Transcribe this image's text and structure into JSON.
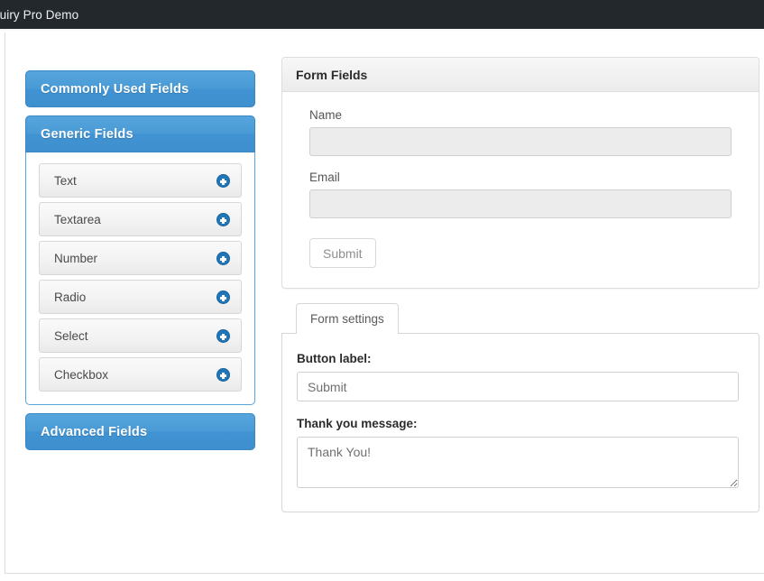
{
  "adminbar": {
    "title": "quiry Pro Demo"
  },
  "sidebar": {
    "panels": [
      {
        "label": "Commonly Used Fields",
        "state": "collapsed"
      },
      {
        "label": "Generic Fields",
        "state": "expanded"
      },
      {
        "label": "Advanced Fields",
        "state": "collapsed"
      }
    ],
    "generic_fields": [
      {
        "label": "Text",
        "icon": "plus-circle-icon"
      },
      {
        "label": "Textarea",
        "icon": "plus-circle-icon"
      },
      {
        "label": "Number",
        "icon": "plus-circle-icon"
      },
      {
        "label": "Radio",
        "icon": "plus-circle-icon"
      },
      {
        "label": "Select",
        "icon": "plus-circle-icon"
      },
      {
        "label": "Checkbox",
        "icon": "plus-circle-icon"
      }
    ]
  },
  "form_fields_card": {
    "title": "Form Fields",
    "fields": [
      {
        "label": "Name",
        "value": "",
        "placeholder": ""
      },
      {
        "label": "Email",
        "value": "",
        "placeholder": ""
      }
    ],
    "submit_label": "Submit"
  },
  "settings_card": {
    "tabs": [
      {
        "label": "Form settings",
        "active": true
      }
    ],
    "button_label_caption": "Button label:",
    "button_label_value": "Submit",
    "thank_you_caption": "Thank you message:",
    "thank_you_value": "Thank You!"
  },
  "colors": {
    "adminbar_bg": "#23282d",
    "accent_blue": "#4a9ad6",
    "accent_blue_border": "#3b87c4",
    "plus_icon_blue": "#1f76b8",
    "field_gray": "#ececec",
    "panel_border": "#dddddd"
  }
}
